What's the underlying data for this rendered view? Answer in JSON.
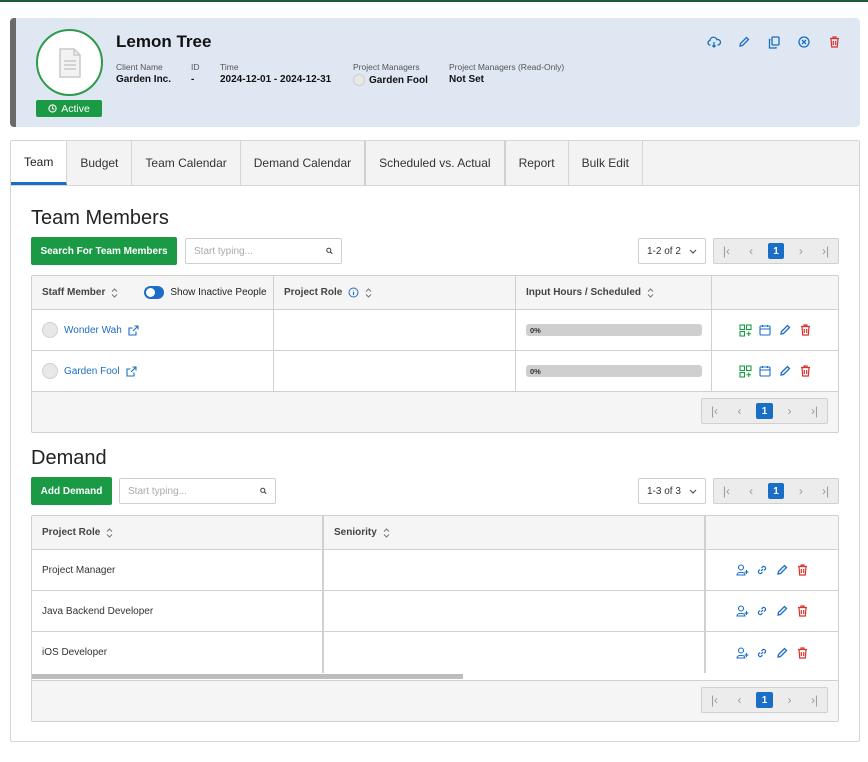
{
  "project": {
    "title": "Lemon Tree",
    "status": "Active",
    "client_label": "Client Name",
    "client_value": "Garden Inc.",
    "id_label": "ID",
    "id_value": "-",
    "time_label": "Time",
    "time_value": "2024-12-01 - 2024-12-31",
    "managers_label": "Project Managers",
    "managers_value": "Garden Fool",
    "managers_ro_label": "Project Managers (Read-Only)",
    "managers_ro_value": "Not Set"
  },
  "tabs": [
    "Team",
    "Budget",
    "Team Calendar",
    "Demand Calendar",
    "Scheduled vs. Actual",
    "Report",
    "Bulk Edit"
  ],
  "team": {
    "title": "Team Members",
    "search_button": "Search For Team Members",
    "search_placeholder": "Start typing...",
    "count": "1-2 of 2",
    "page": "1",
    "columns": {
      "staff": "Staff Member",
      "show_inactive": "Show Inactive People",
      "role": "Project Role",
      "hours": "Input Hours / Scheduled"
    },
    "rows": [
      {
        "name": "Wonder Wah",
        "role": "",
        "progress": "0%"
      },
      {
        "name": "Garden Fool",
        "role": "",
        "progress": "0%"
      }
    ]
  },
  "demand": {
    "title": "Demand",
    "add_button": "Add Demand",
    "search_placeholder": "Start typing...",
    "count": "1-3 of 3",
    "page": "1",
    "columns": {
      "role": "Project Role",
      "seniority": "Seniority"
    },
    "rows": [
      {
        "role": "Project Manager",
        "seniority": ""
      },
      {
        "role": "Java Backend Developer",
        "seniority": ""
      },
      {
        "role": "iOS Developer",
        "seniority": ""
      }
    ]
  },
  "colors": {
    "accent_green": "#1b9a45",
    "accent_blue": "#1a6ec5",
    "danger_red": "#d9312b"
  }
}
